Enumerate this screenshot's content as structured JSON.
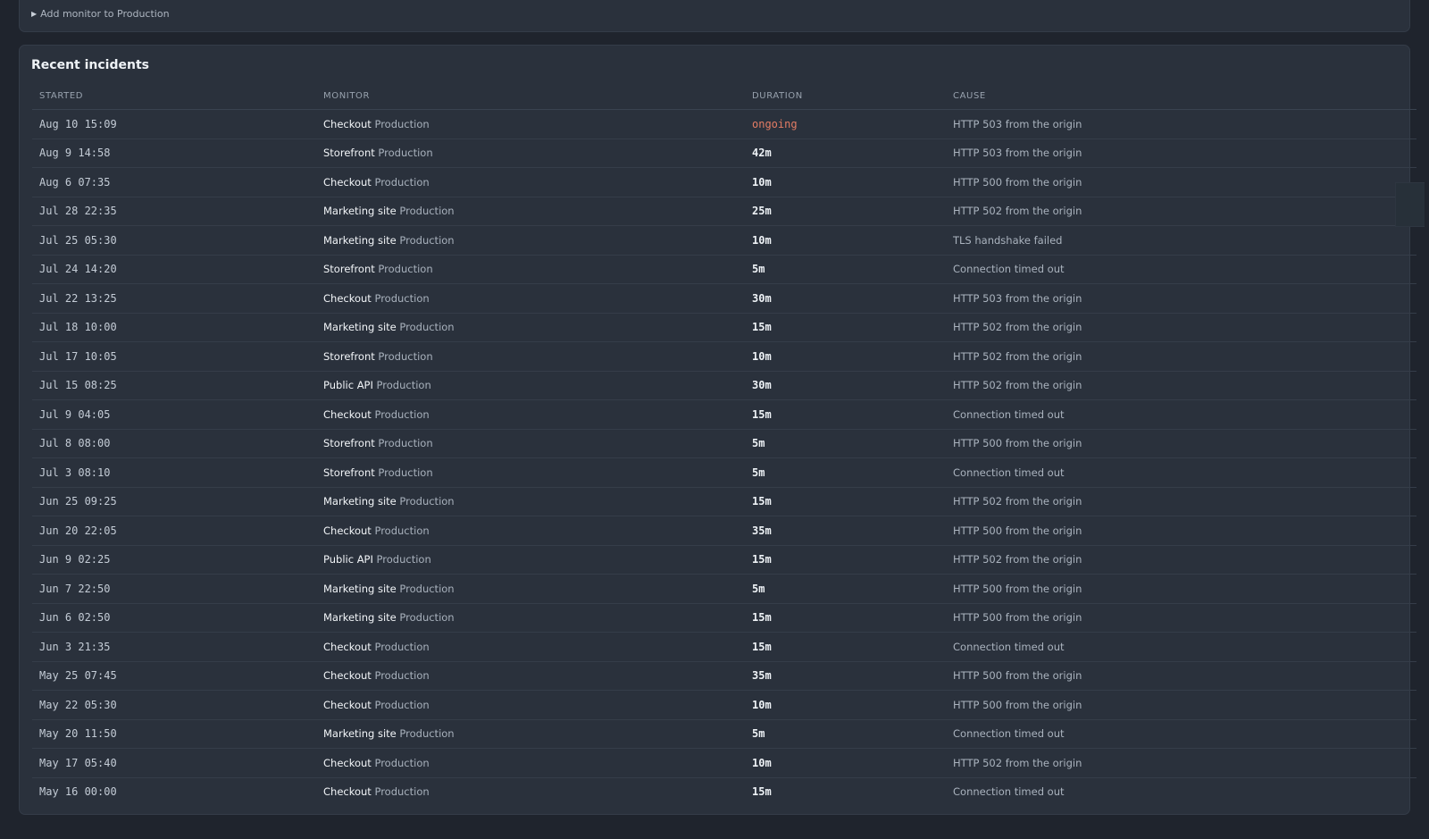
{
  "add_monitor": {
    "label": "Add monitor to Production"
  },
  "incidents": {
    "title": "Recent incidents",
    "columns": [
      "STARTED",
      "MONITOR",
      "DURATION",
      "CAUSE"
    ],
    "rows": [
      {
        "started": "Aug 10 15:09",
        "monitor": "Checkout",
        "env": "Production",
        "duration": "ongoing",
        "cause": "HTTP 503 from the origin"
      },
      {
        "started": "Aug 9 14:58",
        "monitor": "Storefront",
        "env": "Production",
        "duration": "42m",
        "cause": "HTTP 503 from the origin"
      },
      {
        "started": "Aug 6 07:35",
        "monitor": "Checkout",
        "env": "Production",
        "duration": "10m",
        "cause": "HTTP 500 from the origin"
      },
      {
        "started": "Jul 28 22:35",
        "monitor": "Marketing site",
        "env": "Production",
        "duration": "25m",
        "cause": "HTTP 502 from the origin"
      },
      {
        "started": "Jul 25 05:30",
        "monitor": "Marketing site",
        "env": "Production",
        "duration": "10m",
        "cause": "TLS handshake failed"
      },
      {
        "started": "Jul 24 14:20",
        "monitor": "Storefront",
        "env": "Production",
        "duration": "5m",
        "cause": "Connection timed out"
      },
      {
        "started": "Jul 22 13:25",
        "monitor": "Checkout",
        "env": "Production",
        "duration": "30m",
        "cause": "HTTP 503 from the origin"
      },
      {
        "started": "Jul 18 10:00",
        "monitor": "Marketing site",
        "env": "Production",
        "duration": "15m",
        "cause": "HTTP 502 from the origin"
      },
      {
        "started": "Jul 17 10:05",
        "monitor": "Storefront",
        "env": "Production",
        "duration": "10m",
        "cause": "HTTP 502 from the origin"
      },
      {
        "started": "Jul 15 08:25",
        "monitor": "Public API",
        "env": "Production",
        "duration": "30m",
        "cause": "HTTP 502 from the origin"
      },
      {
        "started": "Jul 9 04:05",
        "monitor": "Checkout",
        "env": "Production",
        "duration": "15m",
        "cause": "Connection timed out"
      },
      {
        "started": "Jul 8 08:00",
        "monitor": "Storefront",
        "env": "Production",
        "duration": "5m",
        "cause": "HTTP 500 from the origin"
      },
      {
        "started": "Jul 3 08:10",
        "monitor": "Storefront",
        "env": "Production",
        "duration": "5m",
        "cause": "Connection timed out"
      },
      {
        "started": "Jun 25 09:25",
        "monitor": "Marketing site",
        "env": "Production",
        "duration": "15m",
        "cause": "HTTP 502 from the origin"
      },
      {
        "started": "Jun 20 22:05",
        "monitor": "Checkout",
        "env": "Production",
        "duration": "35m",
        "cause": "HTTP 500 from the origin"
      },
      {
        "started": "Jun 9 02:25",
        "monitor": "Public API",
        "env": "Production",
        "duration": "15m",
        "cause": "HTTP 502 from the origin"
      },
      {
        "started": "Jun 7 22:50",
        "monitor": "Marketing site",
        "env": "Production",
        "duration": "5m",
        "cause": "HTTP 500 from the origin"
      },
      {
        "started": "Jun 6 02:50",
        "monitor": "Marketing site",
        "env": "Production",
        "duration": "15m",
        "cause": "HTTP 500 from the origin"
      },
      {
        "started": "Jun 3 21:35",
        "monitor": "Checkout",
        "env": "Production",
        "duration": "15m",
        "cause": "Connection timed out"
      },
      {
        "started": "May 25 07:45",
        "monitor": "Checkout",
        "env": "Production",
        "duration": "35m",
        "cause": "HTTP 500 from the origin"
      },
      {
        "started": "May 22 05:30",
        "monitor": "Checkout",
        "env": "Production",
        "duration": "10m",
        "cause": "HTTP 500 from the origin"
      },
      {
        "started": "May 20 11:50",
        "monitor": "Marketing site",
        "env": "Production",
        "duration": "5m",
        "cause": "Connection timed out"
      },
      {
        "started": "May 17 05:40",
        "monitor": "Checkout",
        "env": "Production",
        "duration": "10m",
        "cause": "HTTP 502 from the origin"
      },
      {
        "started": "May 16 00:00",
        "monitor": "Checkout",
        "env": "Production",
        "duration": "15m",
        "cause": "Connection timed out"
      }
    ]
  },
  "colors": {
    "background": "#1f242d",
    "card": "#2a313c",
    "ongoing": "#e47c64"
  }
}
